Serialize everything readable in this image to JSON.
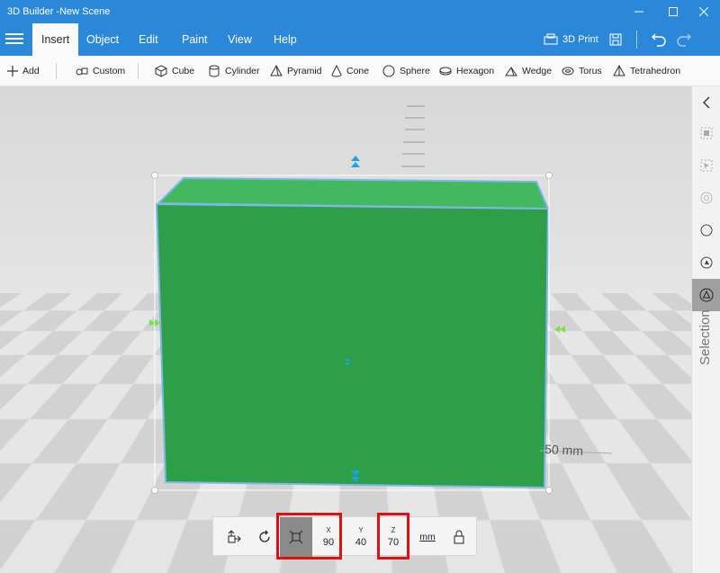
{
  "window": {
    "title": "3D Builder -New Scene"
  },
  "tabs": [
    {
      "label": "Insert",
      "active": true
    },
    {
      "label": "Object"
    },
    {
      "label": "Edit"
    },
    {
      "label": "Paint"
    },
    {
      "label": "View"
    },
    {
      "label": "Help"
    }
  ],
  "ribbon_right": {
    "print_label": "3D Print"
  },
  "toolbar": {
    "add": "Add",
    "custom": "Custom",
    "shapes": [
      "Cube",
      "Cylinder",
      "Pyramid",
      "Cone",
      "Sphere",
      "Hexagon",
      "Wedge",
      "Torus",
      "Tetrahedron"
    ]
  },
  "viewport": {
    "measure_label": "50 mm",
    "object_color": "#2e9e48"
  },
  "sidepanel": {
    "label": "Selection"
  },
  "controls": {
    "x_label": "X",
    "x_value": "90",
    "y_label": "Y",
    "y_value": "40",
    "z_label": "Z",
    "z_value": "70",
    "unit": "mm"
  },
  "colors": {
    "accent": "#2b88d8",
    "highlight": "#e01010",
    "gizmo_blue": "#1aa3e8",
    "gizmo_green": "#7be04a"
  }
}
